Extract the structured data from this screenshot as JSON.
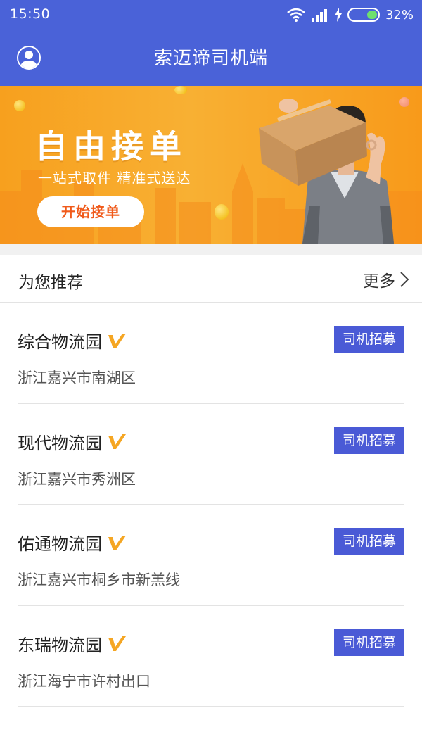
{
  "status_bar": {
    "time": "15:50",
    "battery_percent": "32%"
  },
  "header": {
    "title": "索迈谛司机端"
  },
  "banner": {
    "title": "自由接单",
    "subtitle": "一站式取件 精准式送达",
    "button_label": "开始接单"
  },
  "recommend": {
    "title": "为您推荐",
    "more_label": "更多"
  },
  "items": [
    {
      "name": "综合物流园",
      "address": "浙江嘉兴市南湖区",
      "button": "司机招募"
    },
    {
      "name": "现代物流园",
      "address": "浙江嘉兴市秀洲区",
      "button": "司机招募"
    },
    {
      "name": "佑通物流园",
      "address": "浙江嘉兴市桐乡市新羔线",
      "button": "司机招募"
    },
    {
      "name": "东瑞物流园",
      "address": "浙江海宁市许村出口",
      "button": "司机招募"
    }
  ],
  "colors": {
    "primary": "#4a62d8",
    "button": "#4a5ad6",
    "banner": "#f8a82a",
    "verified": "#f5a623"
  }
}
